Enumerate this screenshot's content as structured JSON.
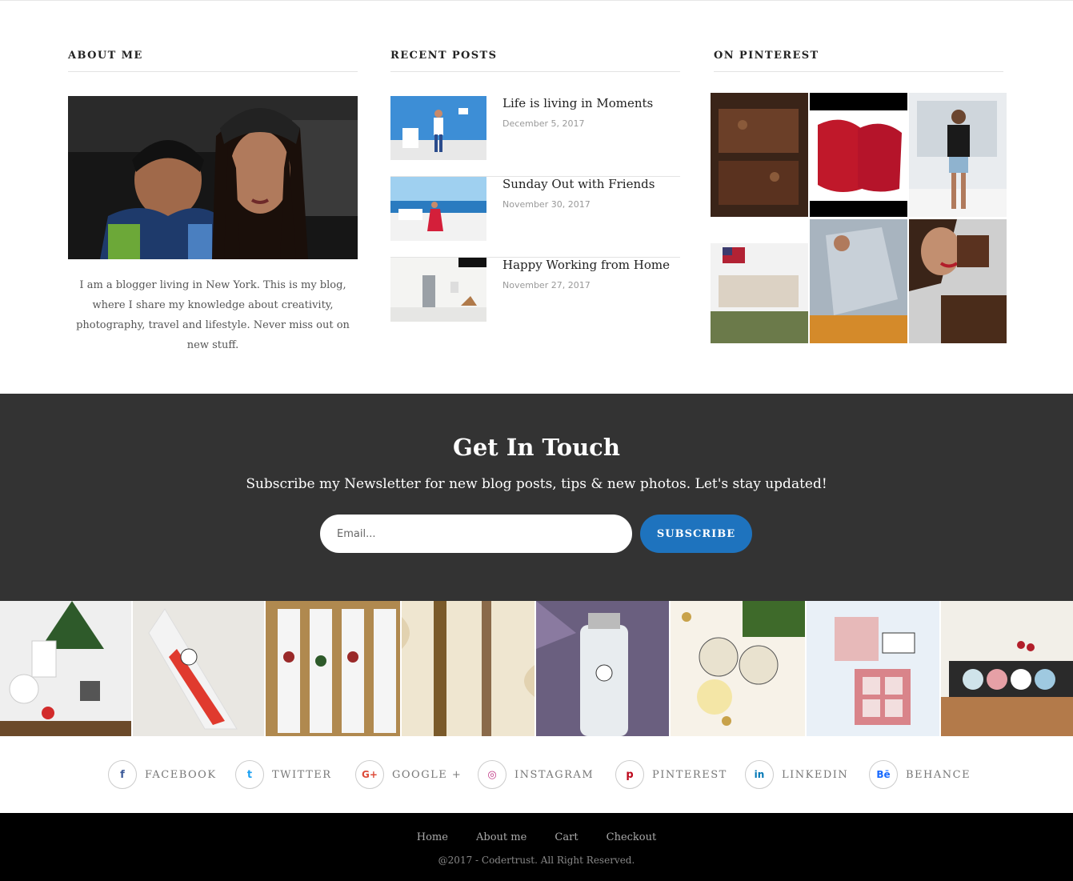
{
  "about": {
    "title": "ABOUT ME",
    "text": "I am a blogger living in New York. This is my blog, where I share my knowledge about creativity, photography, travel and lifestyle. Never miss out on new stuff."
  },
  "recent": {
    "title": "RECENT POSTS",
    "posts": [
      {
        "title": "Life is living in Moments",
        "date": "December 5, 2017"
      },
      {
        "title": "Sunday Out with Friends",
        "date": "November 30, 2017"
      },
      {
        "title": "Happy Working from Home",
        "date": "November 27, 2017"
      }
    ]
  },
  "pinterest": {
    "title": "ON PINTEREST"
  },
  "newsletter": {
    "title": "Get In Touch",
    "subtitle": "Subscribe my Newsletter for new blog posts, tips & new photos. Let's stay updated!",
    "placeholder": "Email...",
    "button": "SUBSCRIBE",
    "button_color": "#1e73be",
    "bg_color": "#333333"
  },
  "social": [
    {
      "label": "FACEBOOK",
      "icon": "facebook-icon",
      "glyph": "f",
      "color": "#3b5998"
    },
    {
      "label": "TWITTER",
      "icon": "twitter-icon",
      "glyph": "t",
      "color": "#1da1f2"
    },
    {
      "label": "GOOGLE +",
      "icon": "google-plus-icon",
      "glyph": "G+",
      "color": "#dd4b39"
    },
    {
      "label": "INSTAGRAM",
      "icon": "instagram-icon",
      "glyph": "◎",
      "color": "#c13584"
    },
    {
      "label": "PINTEREST",
      "icon": "pinterest-icon",
      "glyph": "p",
      "color": "#bd081c"
    },
    {
      "label": "LINKEDIN",
      "icon": "linkedin-icon",
      "glyph": "in",
      "color": "#0077b5"
    },
    {
      "label": "BEHANCE",
      "icon": "behance-icon",
      "glyph": "Bē",
      "color": "#1769ff"
    }
  ],
  "footer": {
    "links": [
      "Home",
      "About me",
      "Cart",
      "Checkout"
    ],
    "copyright": "@2017 - Codertrust. All Right Reserved."
  }
}
